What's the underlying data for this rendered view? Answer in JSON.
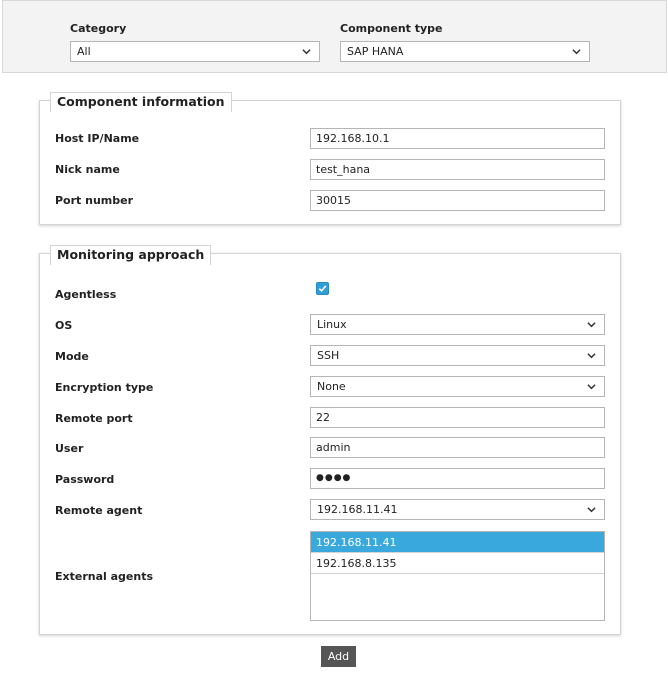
{
  "filters": {
    "category": {
      "label": "Category",
      "value": "All"
    },
    "component_type": {
      "label": "Component type",
      "value": "SAP HANA"
    }
  },
  "component_info": {
    "title": "Component information",
    "host": {
      "label": "Host IP/Name",
      "value": "192.168.10.1"
    },
    "nick": {
      "label": "Nick name",
      "value": "test_hana"
    },
    "port": {
      "label": "Port number",
      "value": "30015"
    }
  },
  "monitoring": {
    "title": "Monitoring approach",
    "agentless": {
      "label": "Agentless",
      "checked": true
    },
    "os": {
      "label": "OS",
      "value": "Linux"
    },
    "mode": {
      "label": "Mode",
      "value": "SSH"
    },
    "encryption": {
      "label": "Encryption type",
      "value": "None"
    },
    "remote_port": {
      "label": "Remote port",
      "value": "22"
    },
    "user": {
      "label": "User",
      "value": "admin"
    },
    "password": {
      "label": "Password",
      "value": "●●●●"
    },
    "remote_agent": {
      "label": "Remote agent",
      "value": "192.168.11.41"
    },
    "external_agents": {
      "label": "External agents",
      "items": [
        "192.168.11.41",
        "192.168.8.135"
      ],
      "selected_index": 0
    }
  },
  "actions": {
    "add_label": "Add"
  },
  "colors": {
    "accent": "#39a8dc",
    "button": "#555555",
    "panel_bg": "#f3f3f3"
  }
}
